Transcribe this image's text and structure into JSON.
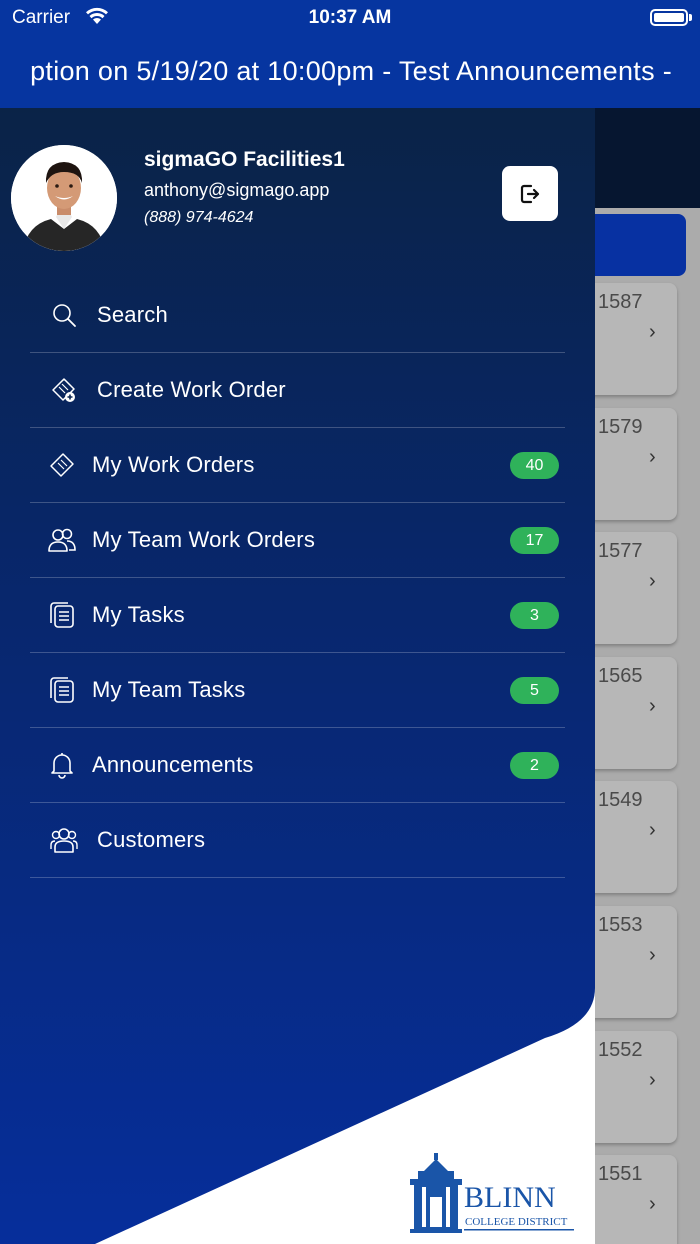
{
  "status_bar": {
    "carrier": "Carrier",
    "time": "10:37 AM"
  },
  "announcement_ticker": {
    "text": "ption on 5/19/20 at 10:00pm - Test Announcements -"
  },
  "profile": {
    "name": "sigmaGO Facilities1",
    "email": "anthony@sigmago.app",
    "phone": "(888) 974-4624"
  },
  "menu": {
    "items": [
      {
        "label": "Search",
        "icon": "search-icon",
        "badge": ""
      },
      {
        "label": "Create Work Order",
        "icon": "ticket-add-icon",
        "badge": ""
      },
      {
        "label": "My Work Orders",
        "icon": "ticket-icon",
        "badge": "40"
      },
      {
        "label": "My Team Work Orders",
        "icon": "team-icon",
        "badge": "17"
      },
      {
        "label": "My Tasks",
        "icon": "tasks-icon",
        "badge": "3"
      },
      {
        "label": "My Team Tasks",
        "icon": "team-tasks-icon",
        "badge": "5"
      },
      {
        "label": "Announcements",
        "icon": "bell-icon",
        "badge": "2"
      },
      {
        "label": "Customers",
        "icon": "customers-icon",
        "badge": ""
      }
    ]
  },
  "background_list": {
    "items": [
      "1587",
      "1579",
      "1577",
      "1565",
      "1549",
      "1553",
      "1552",
      "1551"
    ]
  },
  "logo": {
    "name": "BLINN",
    "subtitle": "COLLEGE DISTRICT"
  },
  "colors": {
    "drawer_top": "#0a2347",
    "drawer_bottom": "#062e9b",
    "header_blue": "#0635a0",
    "badge_green": "#2fb25a",
    "logo_blue": "#1a55a8"
  }
}
